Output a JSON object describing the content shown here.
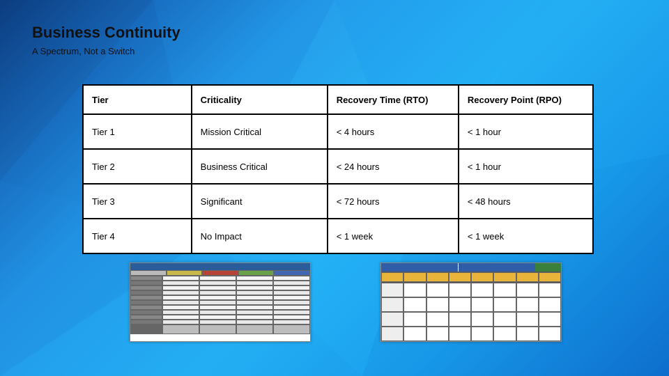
{
  "slide": {
    "title": "Business Continuity",
    "subtitle": "A Spectrum, Not a Switch"
  },
  "table": {
    "headers": [
      "Tier",
      "Criticality",
      "Recovery Time (RTO)",
      "Recovery Point (RPO)"
    ],
    "rows": [
      {
        "tier": "Tier 1",
        "criticality": "Mission Critical",
        "rto": "< 4 hours",
        "rpo": "< 1 hour"
      },
      {
        "tier": "Tier 2",
        "criticality": "Business Critical",
        "rto": "< 24 hours",
        "rpo": "< 1 hour"
      },
      {
        "tier": "Tier 3",
        "criticality": "Significant",
        "rto": "< 72 hours",
        "rpo": "< 48 hours"
      },
      {
        "tier": "Tier 4",
        "criticality": "No Impact",
        "rto": "< 1 week",
        "rpo": "< 1 week"
      }
    ]
  },
  "thumbnails": [
    {
      "name": "bia-matrix-thumbnail"
    },
    {
      "name": "recovery-schedule-thumbnail"
    }
  ]
}
